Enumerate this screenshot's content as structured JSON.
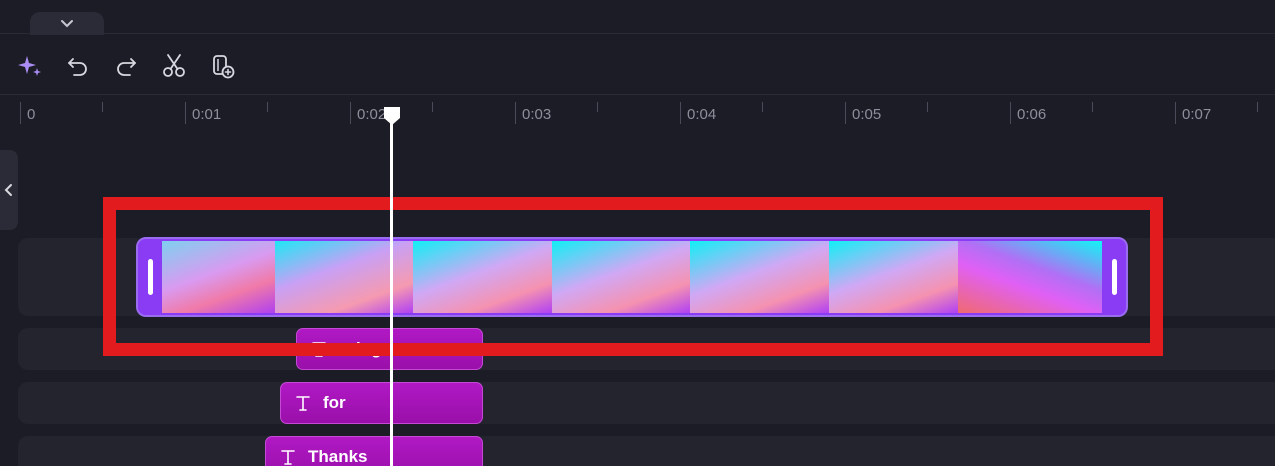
{
  "top_panel": {
    "collapse_icon": "chevron-down-icon"
  },
  "toolbar": {
    "tools": [
      {
        "name": "ai-sparkle-button",
        "icon": "sparkle-icon",
        "color": "#a98cf5"
      },
      {
        "name": "undo-button",
        "icon": "undo-icon"
      },
      {
        "name": "redo-button",
        "icon": "redo-icon"
      },
      {
        "name": "split-button",
        "icon": "scissors-icon"
      },
      {
        "name": "add-media-button",
        "icon": "add-clip-icon"
      }
    ]
  },
  "ruler": {
    "labels": [
      "0",
      "0:01",
      "0:02",
      "0:03",
      "0:04",
      "0:05",
      "0:06",
      "0:07"
    ]
  },
  "timeline": {
    "sidebar_toggle_icon": "chevron-left-icon",
    "video_clip": {
      "accent": "#8a3cf5",
      "frames": 7
    },
    "text_clips": [
      {
        "label": "…ing",
        "icon": "text-icon"
      },
      {
        "label": "for",
        "icon": "text-icon"
      },
      {
        "label": "Thanks",
        "icon": "text-icon"
      }
    ]
  },
  "highlight_color": "#e21b1e",
  "playhead_time": "0:02"
}
